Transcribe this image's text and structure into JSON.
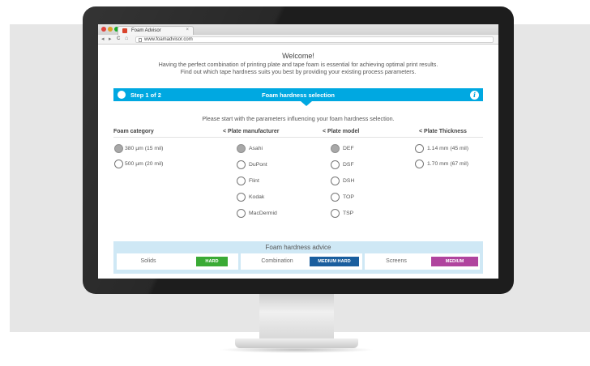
{
  "browser": {
    "tab_title": "Foam Advisor",
    "tab_close": "×",
    "url": "www.foamadvisor.com",
    "traffic_lights": [
      "#e0443e",
      "#dea123",
      "#1aab29"
    ],
    "nav": {
      "back": "◂",
      "forward": "▸",
      "reload": "C",
      "home": "⌂"
    }
  },
  "page": {
    "welcome": "Welcome!",
    "intro_line1": "Having the perfect combination of printing plate and tape foam is essential for achieving optimal print results.",
    "intro_line2": "Find out which tape hardness suits you best by providing your existing process parameters.",
    "step": {
      "label": "Step 1 of 2",
      "title": "Foam hardness selection",
      "info_icon": "i"
    },
    "instruction": "Please start with the parameters influencing your foam hardness selection.",
    "columns": {
      "foam_category": {
        "header": "Foam category",
        "options": [
          {
            "label": "380 µm (15 mil)",
            "selected": true
          },
          {
            "label": "500 µm (20 mil)",
            "selected": false
          }
        ]
      },
      "plate_manufacturer": {
        "header": "< Plate manufacturer",
        "options": [
          {
            "label": "Asahi",
            "selected": true
          },
          {
            "label": "DuPont",
            "selected": false
          },
          {
            "label": "Flint",
            "selected": false
          },
          {
            "label": "Kodak",
            "selected": false
          },
          {
            "label": "MacDermid",
            "selected": false
          }
        ]
      },
      "plate_model": {
        "header": "< Plate model",
        "options": [
          {
            "label": "DEF",
            "selected": true
          },
          {
            "label": "DSF",
            "selected": false
          },
          {
            "label": "DSH",
            "selected": false
          },
          {
            "label": "TOP",
            "selected": false
          },
          {
            "label": "TSP",
            "selected": false
          }
        ]
      },
      "plate_thickness": {
        "header": "< Plate Thickness",
        "options": [
          {
            "label": "1.14 mm (45 mil)",
            "selected": false
          },
          {
            "label": "1.70 mm (67 mil)",
            "selected": false
          }
        ]
      }
    },
    "advice": {
      "title": "Foam hardness advice",
      "items": [
        {
          "name": "Solids",
          "badge": "HARD",
          "color": "#3aaa35"
        },
        {
          "name": "Combination",
          "badge": "MEDIUM HARD",
          "color": "#1a5e9e"
        },
        {
          "name": "Screens",
          "badge": "MEDIUM",
          "color": "#b0449e"
        }
      ]
    }
  },
  "colors": {
    "accent": "#00a8e1",
    "advice_bg": "#cfe8f5",
    "monitor": "#1d1d1d"
  }
}
